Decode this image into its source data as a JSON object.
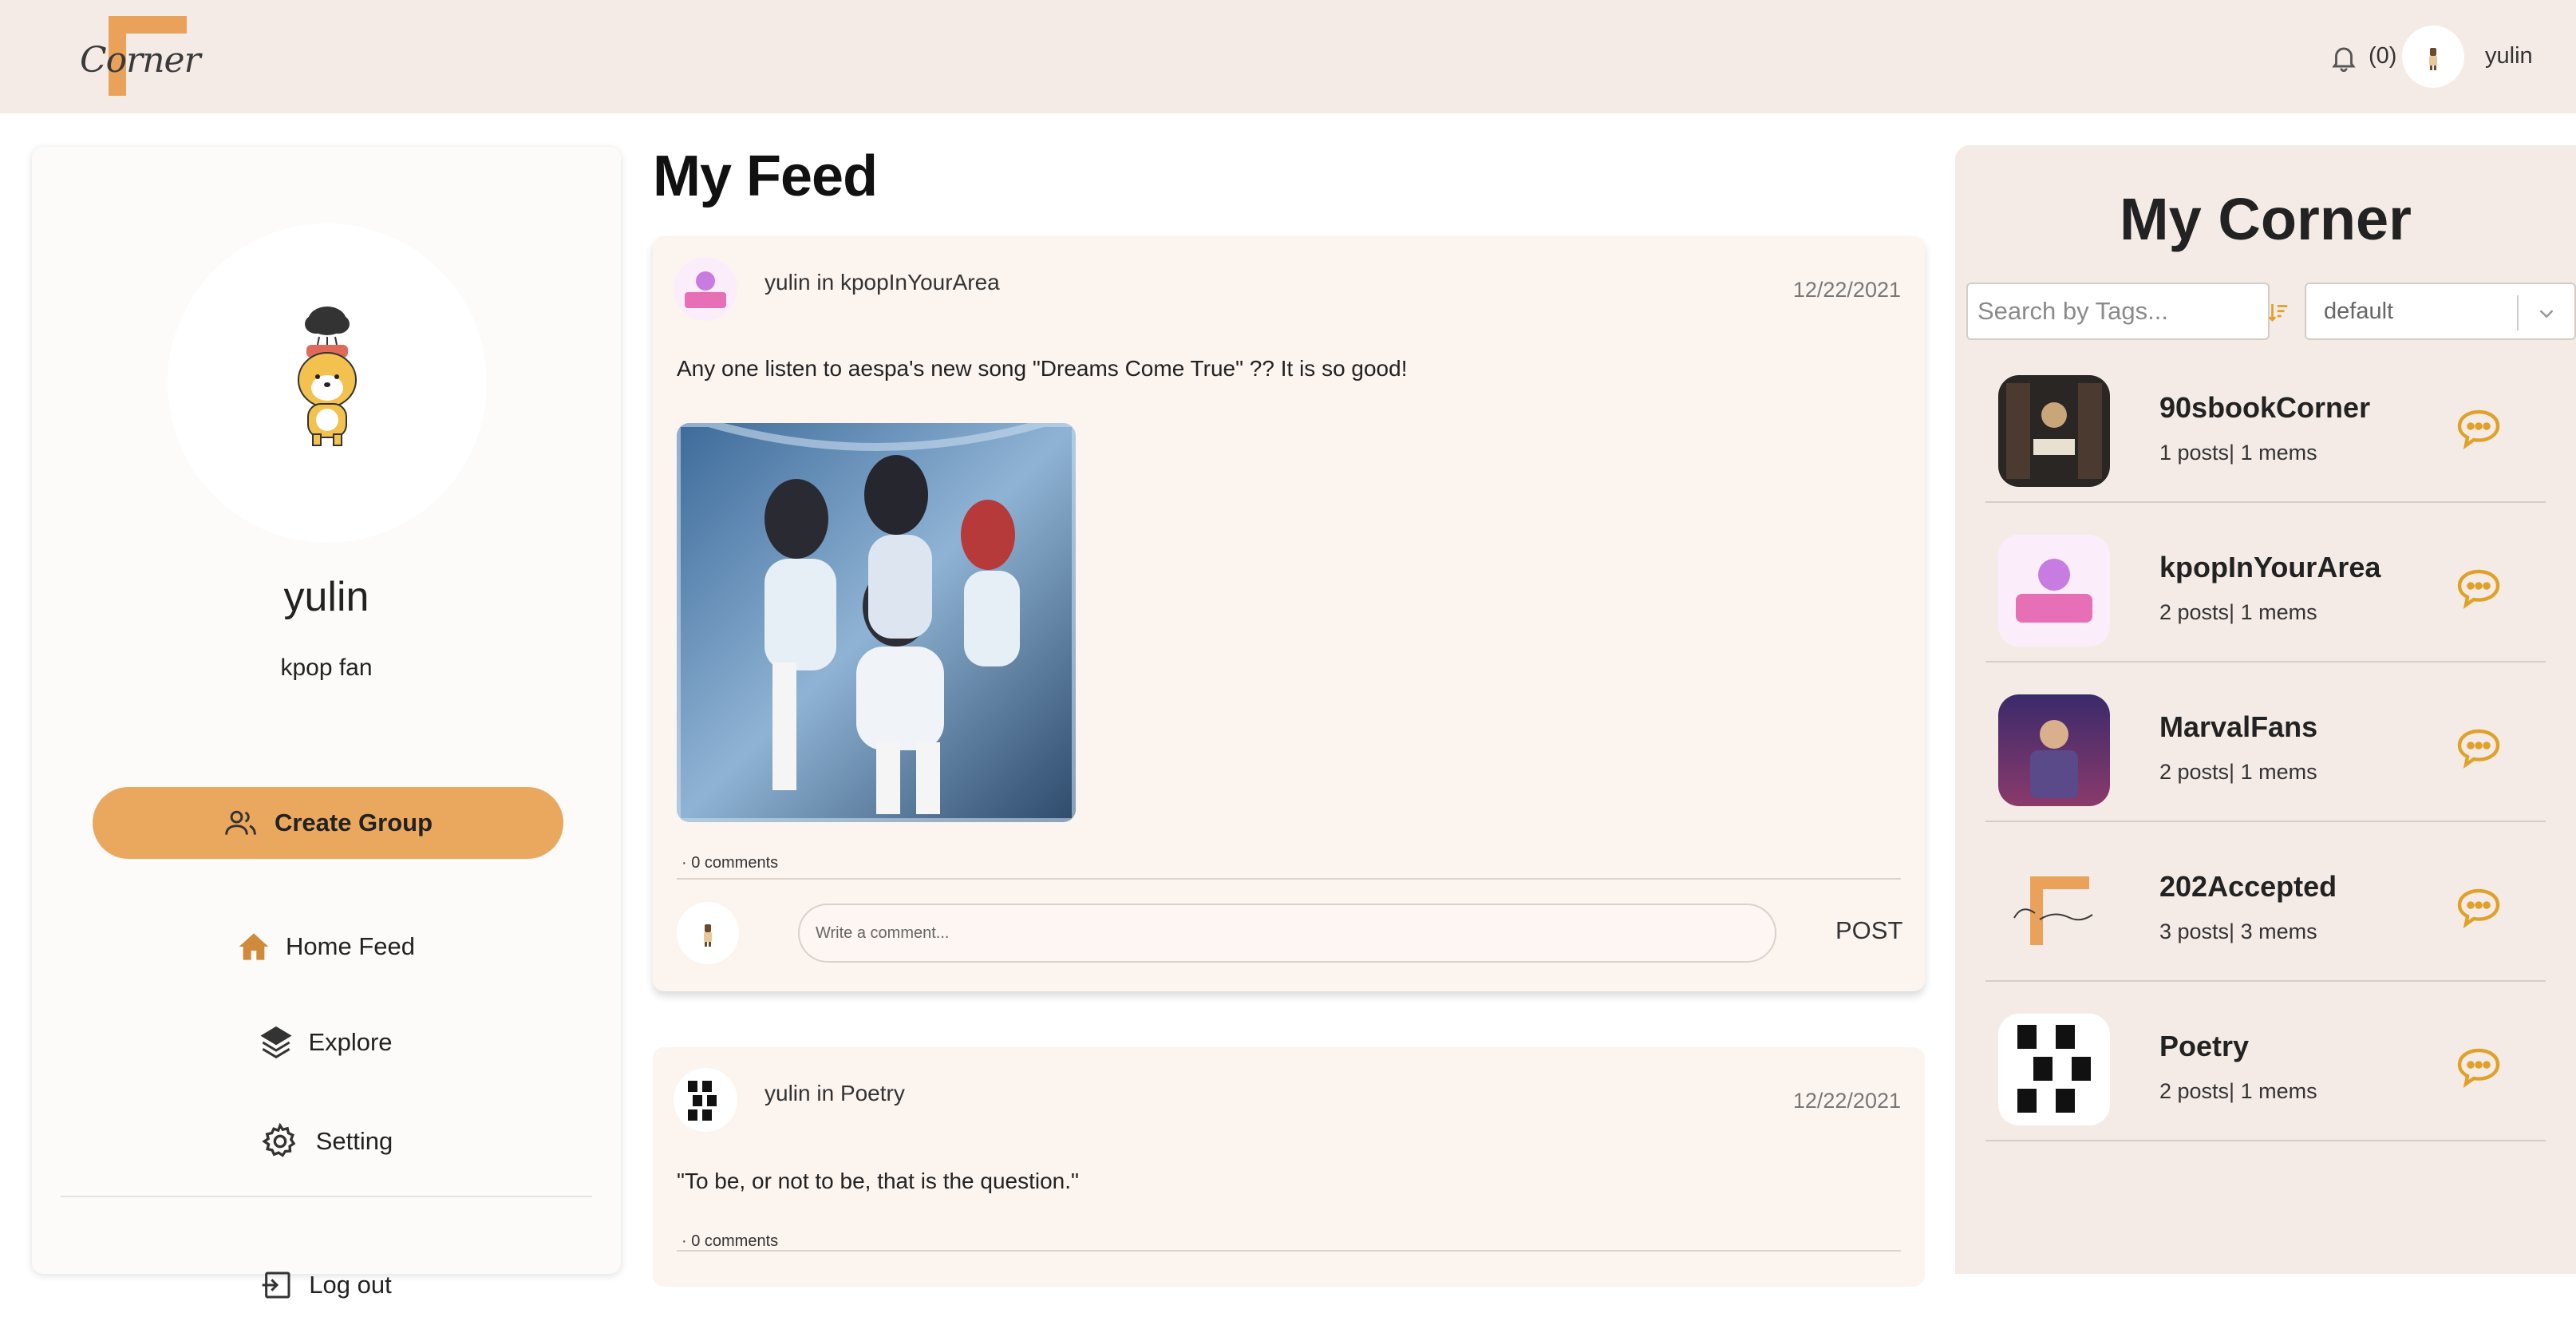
{
  "header": {
    "logo_text": "Corner",
    "notification_count": "(0)",
    "username": "yulin"
  },
  "sidebar": {
    "name": "yulin",
    "bio": "kpop fan",
    "create_group_label": "Create Group",
    "nav": [
      {
        "label": "Home Feed",
        "icon": "home-icon"
      },
      {
        "label": "Explore",
        "icon": "layers-icon"
      },
      {
        "label": "Setting",
        "icon": "gear-icon"
      },
      {
        "label": "Log out",
        "icon": "logout-icon"
      }
    ]
  },
  "feed": {
    "title": "My Feed",
    "posts": [
      {
        "author": "yulin in kpopInYourArea",
        "date": "12/22/2021",
        "text": "Any one listen to aespa's new song \"Dreams Come True\" ?? It is so good!",
        "comments": "· 0 comments",
        "comment_placeholder": "Write a comment...",
        "post_label": "POST"
      },
      {
        "author": "yulin in Poetry",
        "date": "12/22/2021",
        "text": "\"To be, or not to be, that is the question.\"",
        "comments": "· 0 comments"
      }
    ]
  },
  "corner": {
    "title": "My Corner",
    "search_placeholder": "Search by Tags...",
    "sort_value": "default",
    "groups": [
      {
        "name": "90sbookCorner",
        "stats": "1 posts| 1 mems"
      },
      {
        "name": "kpopInYourArea",
        "stats": "2 posts| 1 mems"
      },
      {
        "name": "MarvalFans",
        "stats": "2 posts| 1 mems"
      },
      {
        "name": "202Accepted",
        "stats": "3 posts| 3 mems"
      },
      {
        "name": " Poetry",
        "stats": "2 posts| 1 mems"
      }
    ]
  },
  "colors": {
    "accent": "#eaa85e",
    "header_bg": "#f5ebe6",
    "card_bg": "#fcf4ef",
    "chat_icon": "#e0a12a"
  }
}
